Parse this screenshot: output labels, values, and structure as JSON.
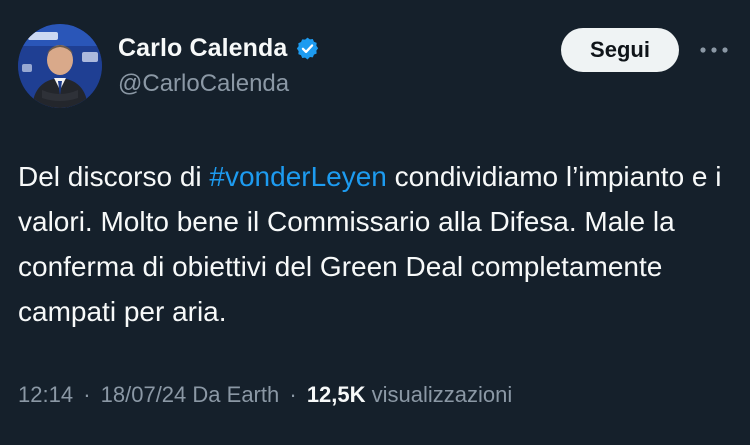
{
  "author": {
    "display_name": "Carlo Calenda",
    "handle": "@CarloCalenda",
    "verified_icon": "verified-badge-icon",
    "avatar_icon": "profile-photo"
  },
  "actions": {
    "follow_label": "Segui",
    "more_icon": "more-options-icon"
  },
  "tweet": {
    "text_before": "Del discorso di ",
    "hashtag": "#vonderLeyen",
    "text_after": " condividiamo l’impianto e i valori. Molto bene il Commissario alla Difesa. Male la conferma di obiettivi del Green Deal completamente campati per aria."
  },
  "meta": {
    "time": "12:14",
    "separator": "·",
    "date": "18/07/24",
    "source": "Da Earth",
    "views_count": "12,5K",
    "views_label": "visualizzazioni"
  },
  "colors": {
    "background": "#15202b",
    "text_primary": "#f7f9f9",
    "text_secondary": "#8b98a5",
    "accent": "#1d9bf0",
    "button_bg": "#eff3f4"
  }
}
